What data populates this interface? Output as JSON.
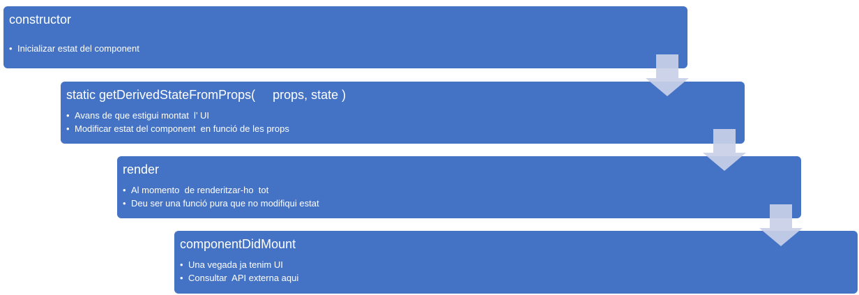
{
  "steps": [
    {
      "title": "constructor",
      "bullets": [
        "Inicializar estat del component"
      ]
    },
    {
      "title": "static getDerivedStateFromProps(     props, state )",
      "bullets": [
        "Avans de que estigui montat  l’ UI",
        "Modificar estat del component  en funció de les props"
      ]
    },
    {
      "title": "render",
      "bullets": [
        "Al momento  de renderitzar-ho  tot",
        "Deu ser una funció pura que no modifiqui estat"
      ]
    },
    {
      "title": "componentDidMount",
      "bullets": [
        "Una vegada ja tenim UI",
        "Consultar  API externa aqui"
      ]
    }
  ],
  "colors": {
    "box": "#4472c4",
    "arrow": "#c9d0e8",
    "text": "#ffffff"
  },
  "icons": {
    "connector": "down-arrow-icon"
  }
}
